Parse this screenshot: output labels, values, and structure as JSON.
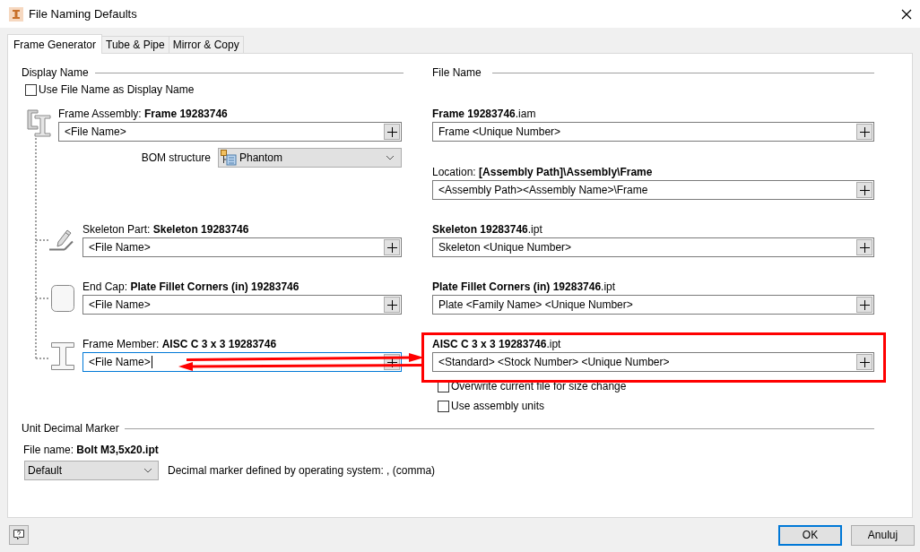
{
  "window": {
    "title": "File Naming Defaults"
  },
  "tabs": [
    {
      "label": "Frame Generator",
      "selected": true
    },
    {
      "label": "Tube & Pipe",
      "selected": false
    },
    {
      "label": "Mirror & Copy",
      "selected": false
    }
  ],
  "display_name": {
    "heading": "Display Name",
    "use_file_name": {
      "label": "Use File Name as Display Name",
      "checked": false
    }
  },
  "file_name": {
    "heading": "File Name"
  },
  "components": [
    {
      "kind": "assembly",
      "label": "Frame Assembly: **Frame 19283746**",
      "value": "<File Name>",
      "focused": false,
      "file_label": "**Frame 19283746**.iam",
      "file_value": "Frame <Unique Number>",
      "bom": {
        "label": "BOM structure",
        "value": "Phantom"
      },
      "location": {
        "label": "Location: **[Assembly Path]\\Assembly\\Frame**",
        "value": "<Assembly Path><Assembly Name>\\Frame"
      }
    },
    {
      "kind": "skeleton",
      "label": "Skeleton Part: **Skeleton 19283746**",
      "value": "<File Name>",
      "focused": false,
      "file_label": "**Skeleton 19283746**.ipt",
      "file_value": "Skeleton <Unique Number>"
    },
    {
      "kind": "end_cap",
      "label": "End Cap: **Plate Fillet Corners (in) 19283746**",
      "value": "<File Name>",
      "focused": false,
      "file_label": "**Plate Fillet Corners (in) 19283746**.ipt",
      "file_value": "Plate <Family Name> <Unique Number>"
    },
    {
      "kind": "member",
      "label": "Frame Member: **AISC C 3 x 3 19283746**",
      "value": "<File Name>",
      "focused": true,
      "file_label": "**AISC C 3 x 3 19283746**.ipt",
      "file_value": "<Standard> <Stock Number> <Unique Number>",
      "options": [
        {
          "label": "Overwrite current file for size change",
          "checked": false
        },
        {
          "label": "Use assembly units",
          "checked": false
        }
      ]
    }
  ],
  "unit_decimal": {
    "heading": "Unit Decimal Marker",
    "file_name": "File name: **Bolt M3,5x20.ipt**",
    "select": "Default",
    "note": "Decimal marker defined by operating system: , (comma)"
  },
  "buttons": [
    {
      "label": "OK",
      "default": true
    },
    {
      "label": "Anuluj",
      "default": false
    }
  ]
}
